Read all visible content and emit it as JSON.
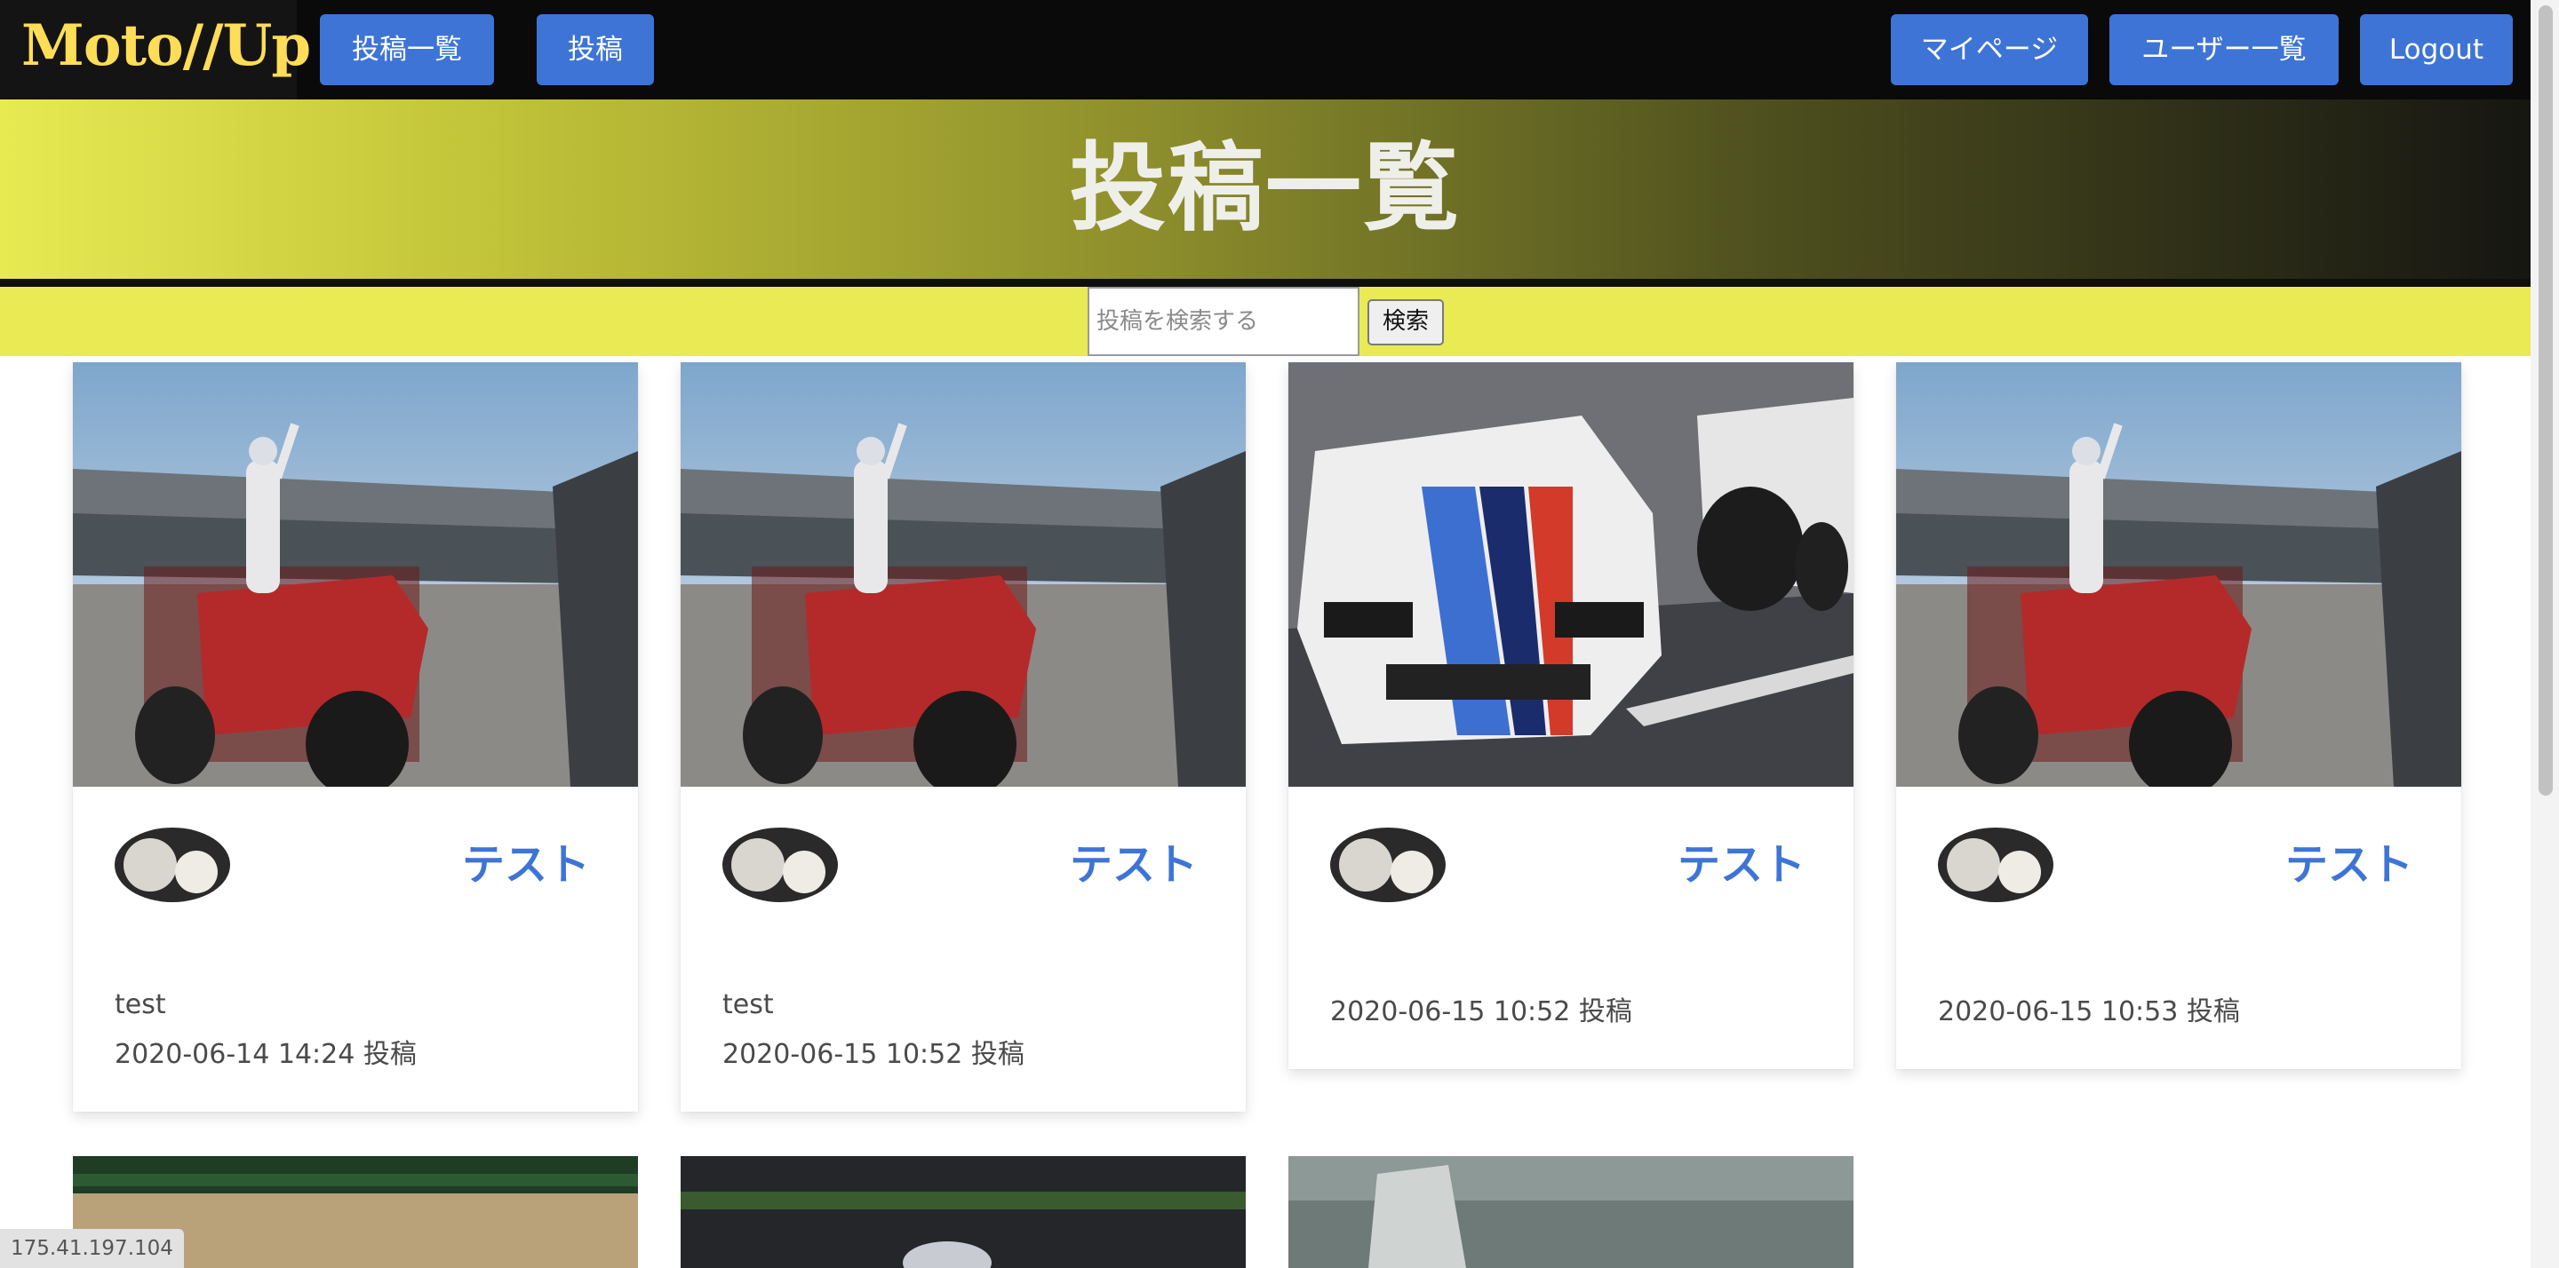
{
  "nav": {
    "brand": "Moto//Up",
    "posts_list": "投稿一覧",
    "post": "投稿",
    "mypage": "マイページ",
    "users_list": "ユーザー一覧",
    "logout": "Logout"
  },
  "hero": {
    "title": "投稿一覧"
  },
  "search": {
    "placeholder": "投稿を検索する",
    "button": "検索"
  },
  "posts": [
    {
      "title": "テスト",
      "body": "test",
      "date": "2020-06-14 14:24 投稿"
    },
    {
      "title": "テスト",
      "body": "test",
      "date": "2020-06-15 10:52 投稿"
    },
    {
      "title": "テスト",
      "body": "",
      "date": "2020-06-15 10:52 投稿"
    },
    {
      "title": "テスト",
      "body": "",
      "date": "2020-06-15 10:53 投稿"
    }
  ],
  "footer": {
    "ip": "175.41.197.104"
  },
  "colors": {
    "accent": "#3e74d6",
    "brand": "#ffdd57",
    "band": "#e9ea54",
    "nav_bg": "#0a0a0a"
  }
}
